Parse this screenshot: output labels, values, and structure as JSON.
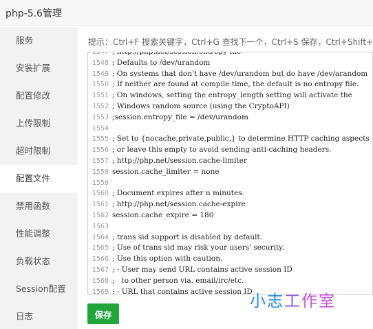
{
  "window": {
    "title": "php-5.6管理"
  },
  "sidebar": {
    "items": [
      {
        "label": "服务"
      },
      {
        "label": "安装扩展"
      },
      {
        "label": "配置修改"
      },
      {
        "label": "上传限制"
      },
      {
        "label": "超时限制"
      },
      {
        "label": "配置文件",
        "active": true
      },
      {
        "label": "禁用函数"
      },
      {
        "label": "性能调整"
      },
      {
        "label": "负载状态"
      },
      {
        "label": "Session配置"
      },
      {
        "label": "日志"
      }
    ]
  },
  "main": {
    "hint": "提示：Ctrl+F 搜索关键字，Ctrl+G 查找下一个，Ctrl+S 保存，Ctrl+Shift+R 查",
    "editor": {
      "lines": [
        {
          "n": "1547",
          "text": "; http://php.net/session.entropy-file"
        },
        {
          "n": "1548",
          "text": "; Defaults to /dev/urandom"
        },
        {
          "n": "1549",
          "text": "; On systems that don't have /dev/urandom but do have /dev/arandom"
        },
        {
          "n": "1550",
          "text": "; If neither are found at compile time, the default is no entropy file."
        },
        {
          "n": "1551",
          "text": "; On windows, setting the entropy_length setting will activate the"
        },
        {
          "n": "1552",
          "text": "; Windows random source (using the CryptoAPI)"
        },
        {
          "n": "1553",
          "text": ";session.entropy_file = /dev/urandom"
        },
        {
          "n": "1554",
          "text": ""
        },
        {
          "n": "1555",
          "text": "; Set to {nocache,private,public,} to determine HTTP caching aspects"
        },
        {
          "n": "1556",
          "text": "; or leave this empty to avoid sending anti-caching headers."
        },
        {
          "n": "1557",
          "text": "; http://php.net/session.cache-limiter"
        },
        {
          "n": "1558",
          "text": "session.cache_limiter = none"
        },
        {
          "n": "1559",
          "text": ""
        },
        {
          "n": "1560",
          "text": "; Document expires after n minutes."
        },
        {
          "n": "1561",
          "text": "; http://php.net/session.cache-expire"
        },
        {
          "n": "1562",
          "text": "session.cache_expire = 180"
        },
        {
          "n": "1563",
          "text": ""
        },
        {
          "n": "1564",
          "text": "; trans sid support is disabled by default."
        },
        {
          "n": "1565",
          "text": "; Use of trans sid may risk your users' security."
        },
        {
          "n": "1566",
          "text": "; Use this option with caution."
        },
        {
          "n": "1567",
          "text": "; - User may send URL contains active session ID"
        },
        {
          "n": "1568",
          "text": ";   to other person via. email/irc/etc."
        },
        {
          "n": "1569",
          "text": "; - URL that contains active session ID"
        }
      ]
    },
    "save_label": "保存"
  },
  "watermark": {
    "part1": "小志",
    "part2": "工",
    "part3": "作室"
  },
  "colors": {
    "accent": "#20a53a",
    "sidebar_bg": "#f2f2f2"
  }
}
